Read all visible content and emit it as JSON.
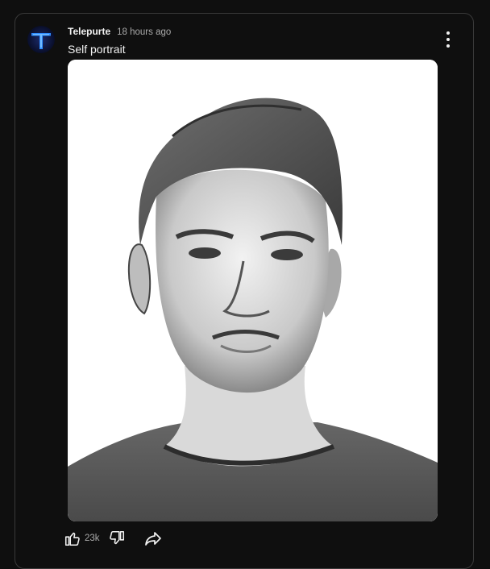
{
  "post": {
    "author": "Telepurte",
    "time": "18 hours ago",
    "text": "Self portrait",
    "likes": "23k"
  },
  "icons": {
    "avatar": "blue-t-logo",
    "menu": "more-vertical-icon",
    "like": "thumbs-up-icon",
    "dislike": "thumbs-down-icon",
    "share": "share-icon"
  },
  "colors": {
    "background": "#0f0f0f",
    "border": "#3a3a3a",
    "text_primary": "#f1f1f1",
    "text_secondary": "#aaaaaa",
    "avatar_accent": "#2a7bff"
  }
}
